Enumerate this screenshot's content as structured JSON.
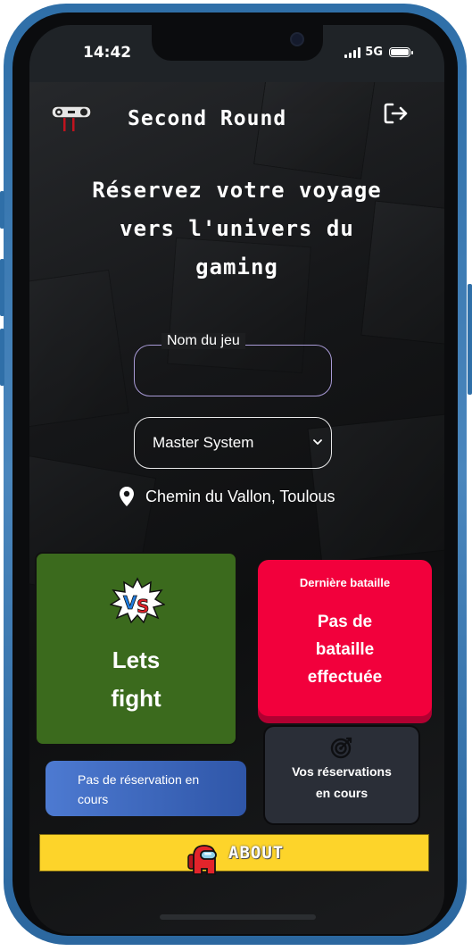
{
  "status_bar": {
    "time": "14:42",
    "network": "5G"
  },
  "header": {
    "title": "Second Round",
    "logo_icon": "robot-controller-icon",
    "logout_icon": "logout-icon"
  },
  "hero": {
    "line1": "Réservez votre voyage",
    "line2": "vers l'univers du",
    "line3": "gaming"
  },
  "search": {
    "label": "Nom du jeu",
    "value": ""
  },
  "console_select": {
    "selected": "Master System"
  },
  "location": {
    "text": "Chemin du Vallon, Toulous"
  },
  "cards": {
    "fight": {
      "line1": "Lets",
      "line2": "fight"
    },
    "last_battle": {
      "title": "Dernière bataille",
      "line1": "Pas de",
      "line2": "bataille",
      "line3": "effectuée"
    },
    "bookings": {
      "line1": "Pas de réservation en",
      "line2": "cours"
    },
    "reservations": {
      "line1": "Vos réservations",
      "line2": "en cours"
    }
  },
  "about": {
    "label": "ABOUT"
  },
  "colors": {
    "fight_card": "#3b6a1d",
    "battle_card": "#f2003c",
    "booking_card": "#3f69bd",
    "reservations_card": "#2a2e37",
    "about_bar": "#fdd42a",
    "input_border": "#a89ad6"
  }
}
